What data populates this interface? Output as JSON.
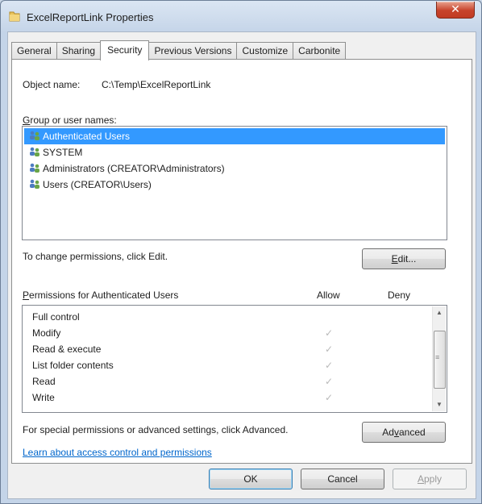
{
  "window": {
    "title": "ExcelReportLink Properties",
    "close_label": "✕"
  },
  "tabs": [
    {
      "label": "General"
    },
    {
      "label": "Sharing"
    },
    {
      "label": "Security",
      "active": true
    },
    {
      "label": "Previous Versions"
    },
    {
      "label": "Customize"
    },
    {
      "label": "Carbonite"
    }
  ],
  "security": {
    "object_name_label": "Object name:",
    "object_name_value": "C:\\Temp\\ExcelReportLink",
    "group_label_key": "G",
    "group_label_rest": "roup or user names:",
    "users": [
      {
        "name": "Authenticated Users",
        "selected": true
      },
      {
        "name": "SYSTEM"
      },
      {
        "name": "Administrators (CREATOR\\Administrators)"
      },
      {
        "name": "Users (CREATOR\\Users)"
      }
    ],
    "change_text": "To change permissions, click Edit.",
    "edit_button": {
      "key": "E",
      "rest": "dit..."
    },
    "perm_label_key": "P",
    "perm_label_rest": "ermissions for Authenticated Users",
    "allow_header": "Allow",
    "deny_header": "Deny",
    "permissions": [
      {
        "name": "Full control",
        "allow": false,
        "deny": false
      },
      {
        "name": "Modify",
        "allow": true,
        "deny": false
      },
      {
        "name": "Read & execute",
        "allow": true,
        "deny": false
      },
      {
        "name": "List folder contents",
        "allow": true,
        "deny": false
      },
      {
        "name": "Read",
        "allow": true,
        "deny": false
      },
      {
        "name": "Write",
        "allow": true,
        "deny": false
      }
    ],
    "check_glyph": "✓",
    "special_text": "For special permissions or advanced settings, click Advanced.",
    "advanced_button": {
      "pre": "Ad",
      "key": "v",
      "rest": "anced"
    },
    "learn_link": "Learn about access control and permissions"
  },
  "buttons": {
    "ok": "OK",
    "cancel": "Cancel",
    "apply_key": "A",
    "apply_rest": "pply"
  },
  "colors": {
    "selection": "#3399ff",
    "link": "#0066cc",
    "close_button": "#c7432b"
  }
}
